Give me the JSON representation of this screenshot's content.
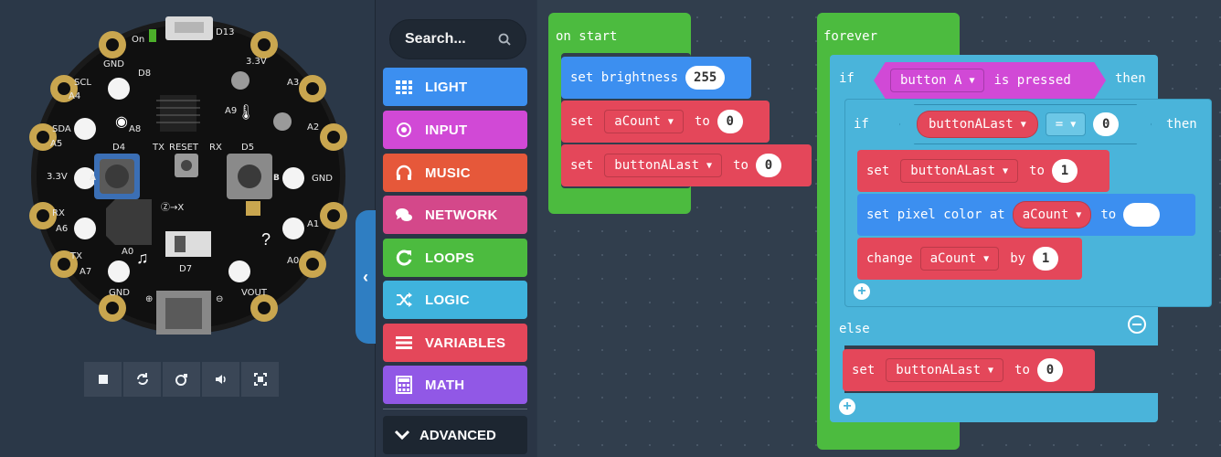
{
  "simulator": {
    "board_labels": {
      "gnd": "GND",
      "scl": "SCL",
      "a4": "A4",
      "sda": "SDA",
      "a5": "A5",
      "v33": "3.3V",
      "rx": "RX",
      "a6": "A6",
      "tx": "TX",
      "a7": "A7",
      "gnd2": "GND",
      "on": "On",
      "d13": "D13",
      "v33r": "3.3V",
      "a3": "A3",
      "a2": "A2",
      "gndr": "GND",
      "a1": "A1",
      "a0": "A0",
      "vout": "VOUT",
      "d8": "D8",
      "a8": "A8",
      "a9": "A9",
      "reset": "RESET",
      "tx_small": "TX",
      "rx_small": "RX",
      "d4": "D4",
      "d5": "D5",
      "a_btn": "A",
      "b_btn": "B",
      "a0_inner": "A0",
      "d7": "D7",
      "plus": "⊕",
      "minus": "⊖",
      "x": "Ⓩ→X"
    },
    "toolbar": [
      "stop-icon",
      "restart-icon",
      "sound-icon",
      "volume-icon",
      "fullscreen-icon"
    ],
    "collapse_glyph": "‹"
  },
  "toolbox": {
    "search_placeholder": "Search...",
    "categories": [
      {
        "label": "LIGHT",
        "color": "#3c8ff0",
        "icon": "light-grid-icon"
      },
      {
        "label": "INPUT",
        "color": "#d149d6",
        "icon": "input-target-icon"
      },
      {
        "label": "MUSIC",
        "color": "#e6583a",
        "icon": "headphones-icon"
      },
      {
        "label": "NETWORK",
        "color": "#d4488a",
        "icon": "chat-icon"
      },
      {
        "label": "LOOPS",
        "color": "#4cbb3f",
        "icon": "refresh-icon"
      },
      {
        "label": "LOGIC",
        "color": "#3fb3dd",
        "icon": "shuffle-icon"
      },
      {
        "label": "VARIABLES",
        "color": "#e4475a",
        "icon": "list-icon"
      },
      {
        "label": "MATH",
        "color": "#9158e6",
        "icon": "calculator-icon"
      }
    ],
    "advanced_label": "ADVANCED"
  },
  "workspace": {
    "on_start": {
      "label": "on start",
      "set_brightness": {
        "text": "set brightness",
        "value": "255"
      },
      "set_acount": {
        "set": "set",
        "var": "aCount",
        "to": "to",
        "value": "0"
      },
      "set_buttonalast": {
        "set": "set",
        "var": "buttonALast",
        "to": "to",
        "value": "0"
      }
    },
    "forever": {
      "label": "forever",
      "if1": {
        "if": "if",
        "button": "button A",
        "is_pressed": "is pressed",
        "then": "then"
      },
      "if2": {
        "if": "if",
        "var": "buttonALast",
        "op": "=",
        "value": "0",
        "then": "then"
      },
      "set_b1": {
        "set": "set",
        "var": "buttonALast",
        "to": "to",
        "value": "1"
      },
      "pixel": {
        "text": "set pixel color at",
        "var": "aCount",
        "to": "to"
      },
      "change": {
        "text": "change",
        "var": "aCount",
        "by": "by",
        "value": "1"
      },
      "else_label": "else",
      "set_b0": {
        "set": "set",
        "var": "buttonALast",
        "to": "to",
        "value": "0"
      }
    },
    "colors": {
      "events": "#4cbb3f",
      "light": "#3c8ff0",
      "variables": "#e4475a",
      "logic": "#4ab4da",
      "input": "#d149d6"
    }
  }
}
